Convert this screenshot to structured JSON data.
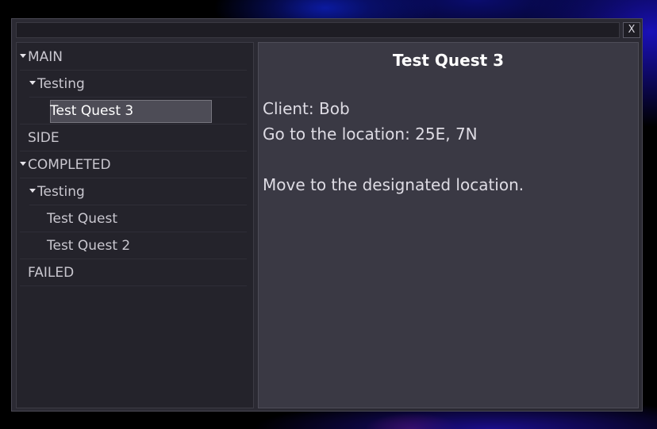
{
  "window": {
    "close_label": "X"
  },
  "tree": {
    "main_label": "MAIN",
    "main_group_label": "Testing",
    "selected_quest": "Test Quest 3",
    "side_label": "SIDE",
    "completed_label": "COMPLETED",
    "completed_group_label": "Testing",
    "completed_quests": [
      "Test Quest",
      "Test Quest 2"
    ],
    "failed_label": "FAILED"
  },
  "detail": {
    "title": "Test Quest 3",
    "client": "Client: Bob",
    "objective": "Go to the location: 25E, 7N",
    "description": "Move to the designated location."
  }
}
